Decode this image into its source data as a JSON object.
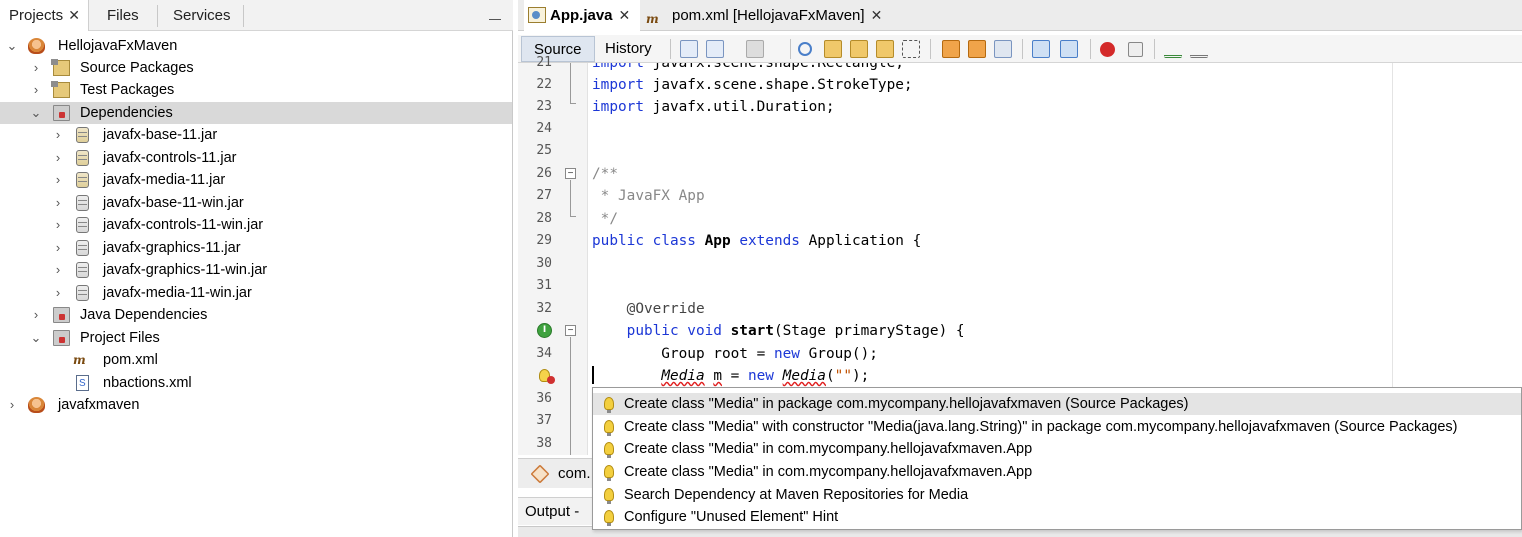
{
  "left_panel": {
    "tabs": [
      {
        "label": "Projects",
        "active": true,
        "closable": true
      },
      {
        "label": "Files",
        "active": false
      },
      {
        "label": "Services",
        "active": false
      }
    ],
    "tree": [
      {
        "label": "HellojavaFxMaven",
        "icon": "maven-project-icon",
        "level": 0,
        "expanded": true
      },
      {
        "label": "Source Packages",
        "icon": "source-packages-icon",
        "level": 1,
        "expanded": false
      },
      {
        "label": "Test Packages",
        "icon": "test-packages-icon",
        "level": 1,
        "expanded": false
      },
      {
        "label": "Dependencies",
        "icon": "dependencies-folder-icon",
        "level": 1,
        "expanded": true,
        "selected": true
      },
      {
        "label": "javafx-base-11.jar",
        "icon": "jar-icon",
        "level": 2,
        "expanded": false
      },
      {
        "label": "javafx-controls-11.jar",
        "icon": "jar-icon",
        "level": 2,
        "expanded": false
      },
      {
        "label": "javafx-media-11.jar",
        "icon": "jar-icon",
        "level": 2,
        "expanded": false
      },
      {
        "label": "javafx-base-11-win.jar",
        "icon": "jar-icon",
        "level": 2,
        "expanded": false
      },
      {
        "label": "javafx-controls-11-win.jar",
        "icon": "jar-icon",
        "level": 2,
        "expanded": false
      },
      {
        "label": "javafx-graphics-11.jar",
        "icon": "jar-icon",
        "level": 2,
        "expanded": false
      },
      {
        "label": "javafx-graphics-11-win.jar",
        "icon": "jar-icon",
        "level": 2,
        "expanded": false
      },
      {
        "label": "javafx-media-11-win.jar",
        "icon": "jar-icon",
        "level": 2,
        "expanded": false
      },
      {
        "label": "Java Dependencies",
        "icon": "java-dependencies-icon",
        "level": 1,
        "expanded": false
      },
      {
        "label": "Project Files",
        "icon": "project-files-icon",
        "level": 1,
        "expanded": true
      },
      {
        "label": "pom.xml",
        "icon": "maven-file-icon",
        "level": 2,
        "leaf": true
      },
      {
        "label": "nbactions.xml",
        "icon": "xml-file-icon",
        "level": 2,
        "leaf": true
      },
      {
        "label": "javafxmaven",
        "icon": "maven-project-icon",
        "level": 0,
        "expanded": false
      }
    ]
  },
  "editor": {
    "tabs": [
      {
        "label": "App.java",
        "active": true,
        "icon": "java-file-icon"
      },
      {
        "label": "pom.xml [HellojavaFxMaven]",
        "active": false,
        "icon": "maven-file-icon"
      }
    ],
    "toolbar": {
      "source_label": "Source",
      "history_label": "History"
    },
    "code_lines": [
      {
        "n": "21",
        "text": "import javafx.scene.shape.Rectangle;"
      },
      {
        "n": "22",
        "text": "import javafx.scene.shape.StrokeType;"
      },
      {
        "n": "23",
        "text": "import javafx.util.Duration;"
      },
      {
        "n": "24",
        "text": ""
      },
      {
        "n": "25",
        "text": ""
      },
      {
        "n": "26",
        "text": "/**"
      },
      {
        "n": "27",
        "text": " * JavaFX App"
      },
      {
        "n": "28",
        "text": " */"
      },
      {
        "n": "29",
        "text": "public class App extends Application {"
      },
      {
        "n": "30",
        "text": ""
      },
      {
        "n": "31",
        "text": ""
      },
      {
        "n": "32",
        "text": "    @Override"
      },
      {
        "n": "33",
        "text": "    public void start(Stage primaryStage) {"
      },
      {
        "n": "34",
        "text": "        Group root = new Group();"
      },
      {
        "n": "35",
        "text": "        Media m = new Media(\"\");"
      },
      {
        "n": "36",
        "text": ""
      },
      {
        "n": "37",
        "text": ""
      },
      {
        "n": "38",
        "text": ""
      }
    ],
    "navigator_tab": "com.",
    "output_tab": "Output - E"
  },
  "hint_popup": {
    "items": [
      "Create class \"Media\" in package com.mycompany.hellojavafxmaven (Source Packages)",
      "Create class \"Media\" with constructor \"Media(java.lang.String)\" in package com.mycompany.hellojavafxmaven (Source Packages)",
      "Create class \"Media\" in com.mycompany.hellojavafxmaven.App",
      "Create class \"Media\" in com.mycompany.hellojavafxmaven.App",
      "Search Dependency at Maven Repositories for Media",
      "Configure \"Unused Element\" Hint"
    ],
    "selected_index": 0
  },
  "colors": {
    "keyword": "#1c37d6",
    "comment": "#888888",
    "error_underline": "#e02020",
    "selection": "#d9d9d9"
  }
}
